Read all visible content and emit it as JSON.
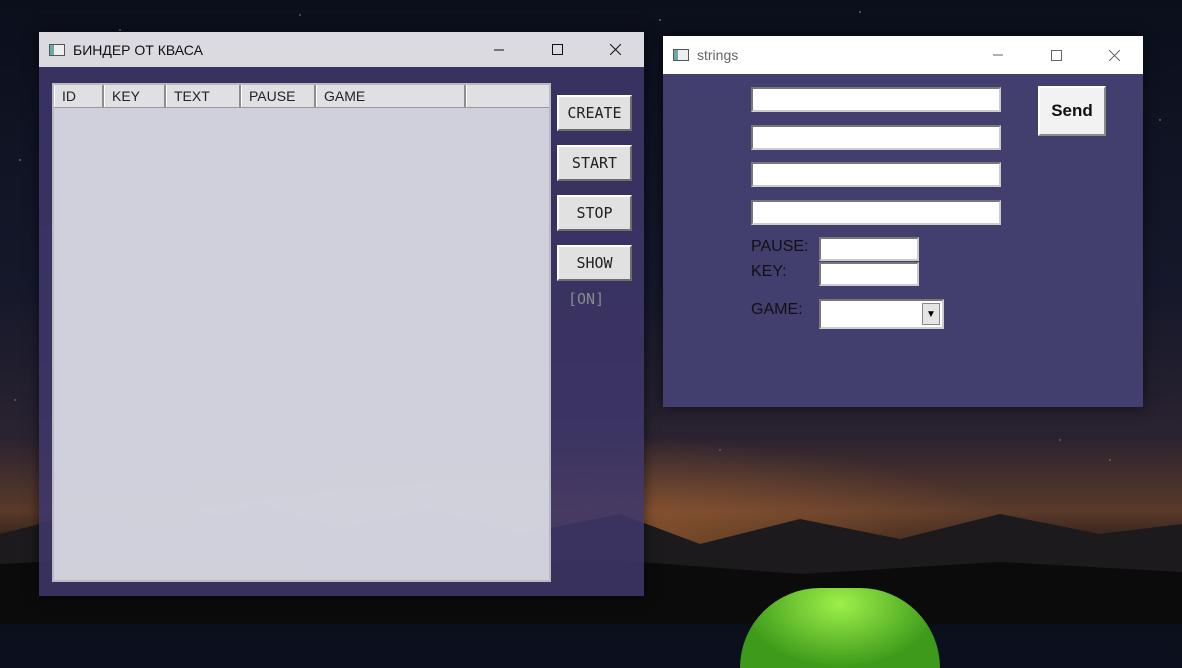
{
  "main_window": {
    "title": "БИНДЕР ОТ КВАСА",
    "columns": [
      "ID",
      "KEY",
      "TEXT",
      "PAUSE",
      "GAME"
    ],
    "buttons": {
      "create": "CREATE",
      "start": "START",
      "stop": "STOP",
      "show": "SHOW"
    },
    "status": "[ON]"
  },
  "strings_window": {
    "title": "strings",
    "send_label": "Send",
    "pause_label": "PAUSE:",
    "key_label": "KEY:",
    "game_label": "GAME:",
    "inputs": [
      "",
      "",
      "",
      ""
    ],
    "pause_value": "",
    "key_value": "",
    "game_value": ""
  }
}
